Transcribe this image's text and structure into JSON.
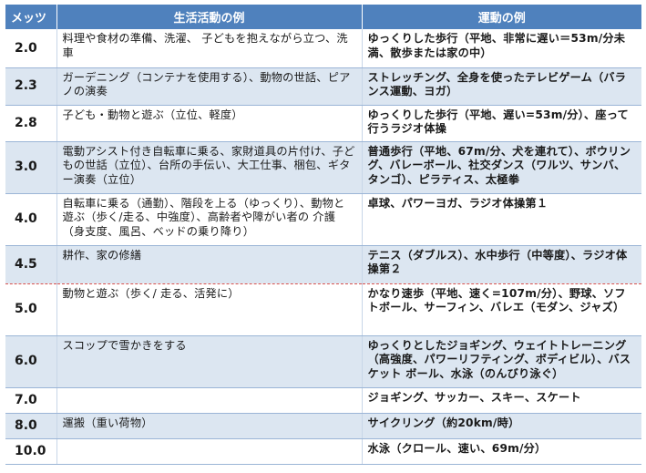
{
  "header": {
    "mets": "メッツ",
    "life": "生活活動の例",
    "exercise": "運動の例"
  },
  "rows": [
    {
      "mets": "2.0",
      "life": "料理や食材の準備、洗濯、 子どもを抱えながら立つ、洗車",
      "exercise": "ゆっくりした歩行（平地、非常に遅い＝53m/分未満、散歩または家の中）"
    },
    {
      "mets": "2.3",
      "life": "ガーデニング（コンテナを使用する）、動物の世話、ピアノの演奏",
      "exercise": "ストレッチング、全身を使ったテレビゲーム（バランス運動、ヨガ）"
    },
    {
      "mets": "2.8",
      "life": "子ども・動物と遊ぶ（立位、軽度）",
      "exercise": "ゆっくりした歩行（平地、遅い=53m/分）、座って行うラジオ体操"
    },
    {
      "mets": "3.0",
      "life": "電動アシスト付き自転車に乗る、家財道具の片付け、子どもの世話（立位）、台所の手伝い、大工仕事、梱包、ギター演奏（立位）",
      "exercise": "普通歩行（平地、67m/分、犬を連れて）、ボウリング、バレーボール、社交ダンス（ワルツ、サンバ、タンゴ）、ピラティス、太極拳"
    },
    {
      "mets": "4.0",
      "life": "自転車に乗る（通勤）、階段を上る（ゆっくり）、動物と遊ぶ（歩く/走る、中強度）、高齢者や障がい者の 介護（身支度、風呂、ベッドの乗り降り）",
      "exercise": "卓球、パワーヨガ、ラジオ体操第１"
    },
    {
      "mets": "4.5",
      "life": "耕作、家の修繕",
      "exercise": "テニス（ダブルス）、水中歩行（中等度）、ラジオ体操第２"
    },
    {
      "mets": "5.0",
      "life": "動物と遊ぶ（歩く/ 走る、活発に）",
      "exercise": "かなり速歩（平地、速く=107m/分）、野球、ソフトボール、サーフィン、バレエ（モダン、ジャズ）"
    },
    {
      "mets": "6.0",
      "life": "スコップで雪かきをする",
      "exercise": "ゆっくりとしたジョギング、ウェイトトレーニング（高強度、パワーリフティング、ボディビル）、バスケット ボール、水泳（のんびり泳ぐ）"
    },
    {
      "mets": "7.0",
      "life": "",
      "exercise": "ジョギング、サッカー、スキー、スケート"
    },
    {
      "mets": "8.0",
      "life": "運搬（重い荷物）",
      "exercise": "サイクリング（約20km/時）"
    },
    {
      "mets": "10.0",
      "life": "",
      "exercise": "水泳（クロール、速い、69m/分）"
    }
  ],
  "colors": {
    "header_bg": "#4f81bd",
    "row_alt_bg": "#dce6f1",
    "dashed_divider": "#d9534f"
  }
}
